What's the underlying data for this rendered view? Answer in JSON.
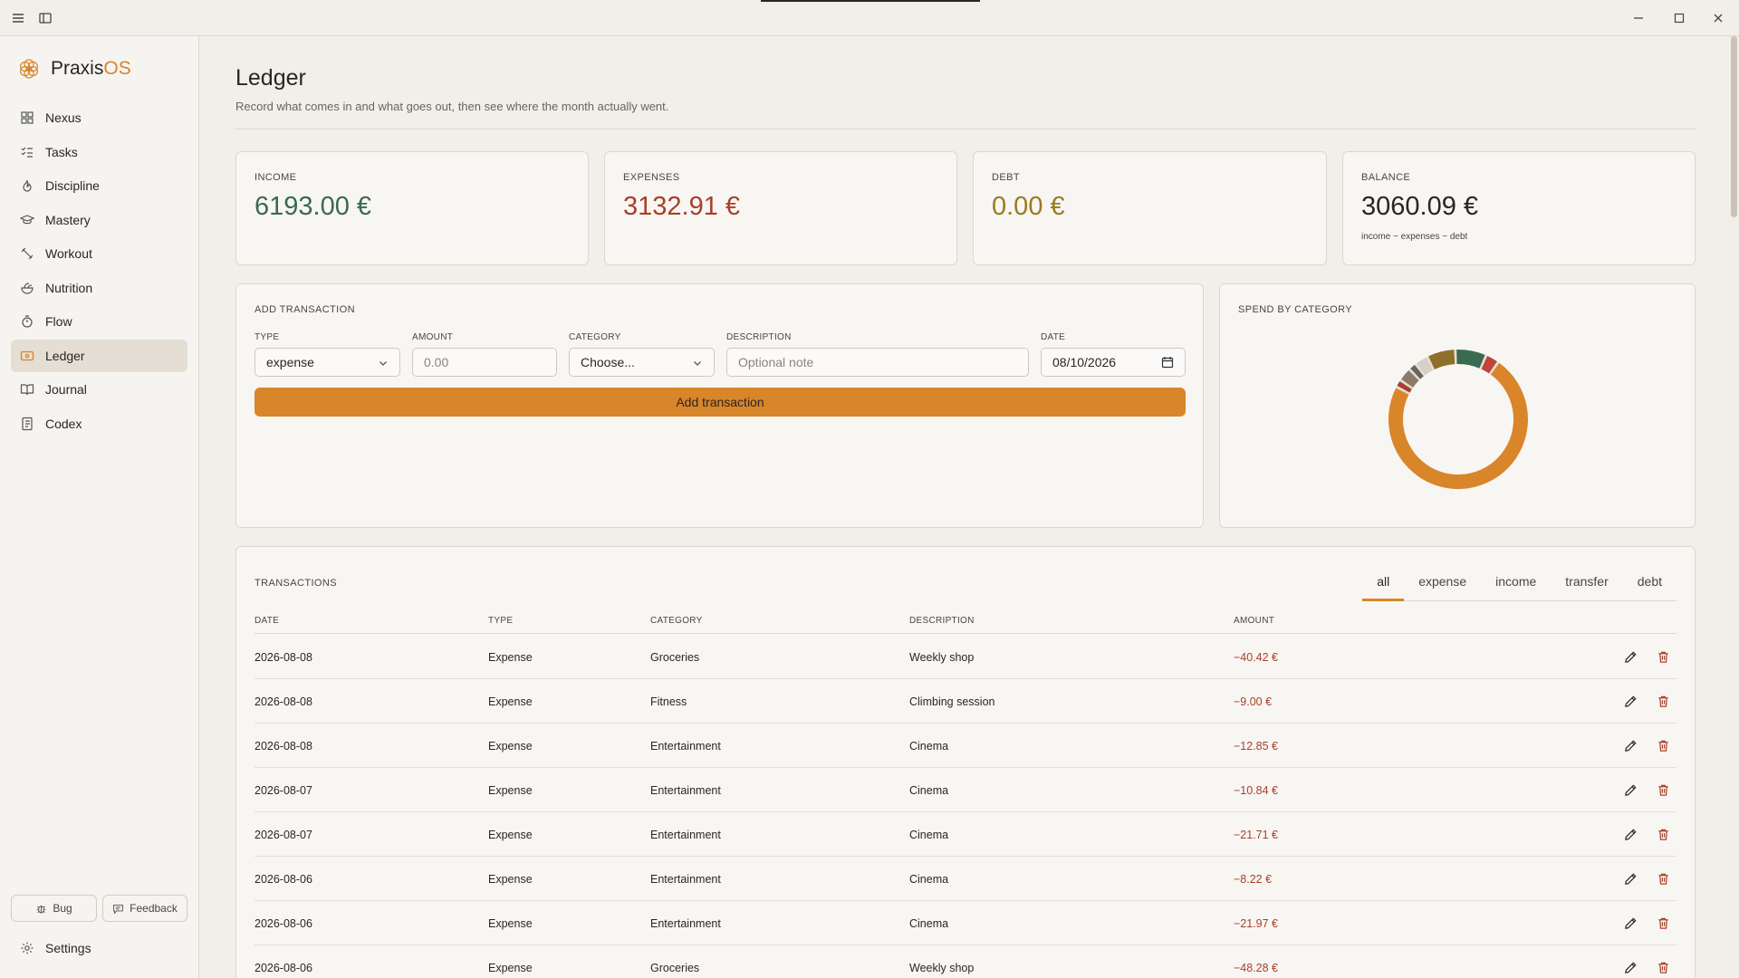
{
  "app": {
    "brand_main": "Praxis",
    "brand_accent": "OS"
  },
  "colors": {
    "accent": "#d9852a",
    "income": "#3a6a4f",
    "expense": "#a8402a",
    "debt": "#9a7a22",
    "balance": "#2a2622"
  },
  "sidebar": {
    "items": [
      {
        "label": "Nexus",
        "icon": "grid-icon"
      },
      {
        "label": "Tasks",
        "icon": "checklist-icon"
      },
      {
        "label": "Discipline",
        "icon": "flame-icon"
      },
      {
        "label": "Mastery",
        "icon": "graduation-cap-icon"
      },
      {
        "label": "Workout",
        "icon": "dumbbell-icon"
      },
      {
        "label": "Nutrition",
        "icon": "salad-icon"
      },
      {
        "label": "Flow",
        "icon": "timer-icon"
      },
      {
        "label": "Ledger",
        "icon": "wallet-icon"
      },
      {
        "label": "Journal",
        "icon": "book-icon"
      },
      {
        "label": "Codex",
        "icon": "notebook-icon"
      }
    ],
    "bug_label": "Bug",
    "feedback_label": "Feedback",
    "settings_label": "Settings"
  },
  "page": {
    "title": "Ledger",
    "subtitle": "Record what comes in and what goes out, then see where the month actually went."
  },
  "stats": {
    "income": {
      "label": "INCOME",
      "value": "6193.00 €"
    },
    "expenses": {
      "label": "EXPENSES",
      "value": "3132.91 €"
    },
    "debt": {
      "label": "DEBT",
      "value": "0.00 €"
    },
    "balance": {
      "label": "BALANCE",
      "value": "3060.09 €",
      "note": "income − expenses − debt"
    }
  },
  "add_form": {
    "title": "ADD TRANSACTION",
    "type_label": "TYPE",
    "type_value": "expense",
    "amount_label": "AMOUNT",
    "amount_placeholder": "0.00",
    "category_label": "CATEGORY",
    "category_value": "Choose...",
    "description_label": "DESCRIPTION",
    "description_placeholder": "Optional note",
    "date_label": "DATE",
    "date_value": "08/10/2026",
    "submit_label": "Add transaction"
  },
  "spend_chart": {
    "title": "SPEND BY CATEGORY"
  },
  "chart_data": {
    "type": "pie",
    "title": "SPEND BY CATEGORY",
    "style": "donut",
    "slices": [
      {
        "value": 74.0,
        "color": "#d9852a"
      },
      {
        "value": 0.6,
        "color": "#e3ddd3"
      },
      {
        "value": 1.2,
        "color": "#a8402a"
      },
      {
        "value": 0.6,
        "color": "#e3ddd3"
      },
      {
        "value": 2.7,
        "color": "#8a7a6a"
      },
      {
        "value": 0.6,
        "color": "#e3ddd3"
      },
      {
        "value": 1.3,
        "color": "#6a645c"
      },
      {
        "value": 0.6,
        "color": "#e3ddd3"
      },
      {
        "value": 2.6,
        "color": "#d6d0c6"
      },
      {
        "value": 0.6,
        "color": "#e3ddd3"
      },
      {
        "value": 6.2,
        "color": "#8f6f2a"
      },
      {
        "value": 0.6,
        "color": "#e3ddd3"
      },
      {
        "value": 6.8,
        "color": "#3a6a4f"
      },
      {
        "value": 0.6,
        "color": "#e3ddd3"
      },
      {
        "value": 2.6,
        "color": "#c0443a"
      },
      {
        "value": 0.6,
        "color": "#e3ddd3"
      }
    ]
  },
  "transactions": {
    "title": "TRANSACTIONS",
    "tabs": [
      "all",
      "expense",
      "income",
      "transfer",
      "debt"
    ],
    "active_tab": "all",
    "columns": [
      "DATE",
      "TYPE",
      "CATEGORY",
      "DESCRIPTION",
      "AMOUNT"
    ],
    "rows": [
      {
        "date": "2026-08-08",
        "type": "Expense",
        "category": "Groceries",
        "description": "Weekly shop",
        "amount": "−40.42 €"
      },
      {
        "date": "2026-08-08",
        "type": "Expense",
        "category": "Fitness",
        "description": "Climbing session",
        "amount": "−9.00 €"
      },
      {
        "date": "2026-08-08",
        "type": "Expense",
        "category": "Entertainment",
        "description": "Cinema",
        "amount": "−12.85 €"
      },
      {
        "date": "2026-08-07",
        "type": "Expense",
        "category": "Entertainment",
        "description": "Cinema",
        "amount": "−10.84 €"
      },
      {
        "date": "2026-08-07",
        "type": "Expense",
        "category": "Entertainment",
        "description": "Cinema",
        "amount": "−21.71 €"
      },
      {
        "date": "2026-08-06",
        "type": "Expense",
        "category": "Entertainment",
        "description": "Cinema",
        "amount": "−8.22 €"
      },
      {
        "date": "2026-08-06",
        "type": "Expense",
        "category": "Entertainment",
        "description": "Cinema",
        "amount": "−21.97 €"
      },
      {
        "date": "2026-08-06",
        "type": "Expense",
        "category": "Groceries",
        "description": "Weekly shop",
        "amount": "−48.28 €"
      }
    ]
  }
}
